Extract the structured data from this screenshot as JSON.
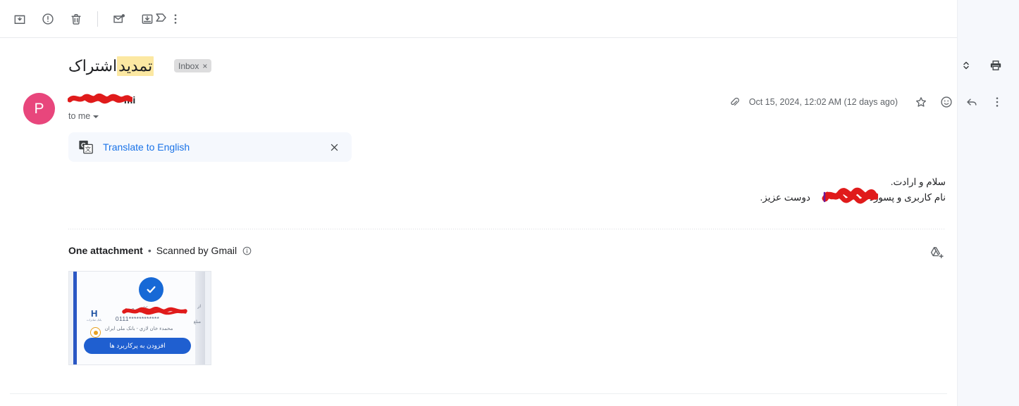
{
  "toolbar": {
    "buttons": [
      {
        "name": "archive",
        "label": "Archive",
        "icon": "archive-icon"
      },
      {
        "name": "report-spam",
        "label": "Report spam",
        "icon": "report-spam-icon"
      },
      {
        "name": "delete",
        "label": "Delete",
        "icon": "trash-icon"
      },
      {
        "name": "mark-unread",
        "label": "Mark as unread",
        "icon": "mark-unread-icon"
      },
      {
        "name": "move-to-inbox",
        "label": "Move to Inbox",
        "icon": "move-to-inbox-icon"
      },
      {
        "name": "more-options",
        "label": "More",
        "icon": "more-vert-icon"
      }
    ]
  },
  "subject": {
    "text_highlight": "تمدید",
    "text_rest": " اشتراک",
    "full": "تمدید اشتراک",
    "highlight_color": "#fce8a2",
    "label_chip": "Inbox",
    "label_chip_remove": "×"
  },
  "subject_actions": {
    "expand": "Expand all",
    "print": "Print all"
  },
  "sender": {
    "avatar_letter": "P",
    "avatar_color": "#e8467c",
    "name": "mi",
    "name_redacted": true,
    "recipient": "to me"
  },
  "message_meta": {
    "date": "Oct 15, 2024, 12:02 AM (12 days ago)",
    "has_attachment": true,
    "actions": [
      "star",
      "add-reaction",
      "reply",
      "more"
    ]
  },
  "translate": {
    "label": "Translate to English",
    "icon": "google-translate-icon",
    "close": "×",
    "link_color": "#1a73e8"
  },
  "body": {
    "line1": "سلام و ارادت.",
    "line2_before": "نام کاربری و پسورد",
    "line2_after": "دوست عزیز.",
    "redaction_color": "#e01b1b"
  },
  "attachments": {
    "title": "One attachment",
    "separator": "•",
    "scanned": "Scanned by Gmail",
    "info_icon": "info-icon",
    "add_to_drive": "Add all to Drive",
    "thumbnail": {
      "card_label": "کارت صیور",
      "card_number": "************0111",
      "card_owner": "محمدء خان لازي - بانک ملی ایران",
      "side_text_1": "از",
      "side_text_2": "مبلغ",
      "button_label": "افزودن به پرکاربرد ها",
      "bank_mark": "H",
      "bank_mark_sub": "بانک صادرات",
      "badge_sub": "ملی"
    }
  }
}
